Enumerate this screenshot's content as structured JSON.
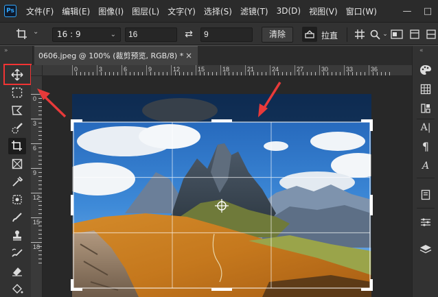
{
  "app": {
    "logo": "Ps"
  },
  "menu": [
    "文件(F)",
    "编辑(E)",
    "图像(I)",
    "图层(L)",
    "文字(Y)",
    "选择(S)",
    "滤镜(T)",
    "3D(D)",
    "视图(V)",
    "窗口(W)"
  ],
  "window_controls": {
    "minimize": "—",
    "maximize": "□"
  },
  "options_bar": {
    "tool_icon": "crop-icon",
    "ratio": "16 : 9",
    "width_value": "16",
    "height_value": "9",
    "swap_icon": "swap-icon",
    "clear_label": "清除",
    "straighten_label": "拉直",
    "icons": [
      "grid-overlay-icon",
      "settings-gear-icon",
      "content-aware-icon"
    ]
  },
  "document": {
    "tab_title": "0606.jpeg @ 100% (裁剪预览, RGB/8) *",
    "close_label": "×"
  },
  "ruler": {
    "h_labels": [
      "0",
      "3",
      "6",
      "9",
      "12",
      "15",
      "18",
      "21",
      "24",
      "27",
      "30",
      "33",
      "36"
    ],
    "v_labels": [
      "0",
      "3",
      "6",
      "9",
      "12",
      "15",
      "18"
    ]
  },
  "toolbar": {
    "tools": [
      "move-tool-icon",
      "marquee-tool-icon",
      "lasso-tool-icon",
      "quick-select-tool-icon",
      "crop-tool-icon",
      "frame-tool-icon",
      "eyedropper-tool-icon",
      "healing-brush-tool-icon",
      "brush-tool-icon",
      "clone-stamp-tool-icon",
      "history-brush-tool-icon",
      "eraser-tool-icon",
      "fill-tool-icon"
    ],
    "active_tool": "crop-tool-icon",
    "highlighted_tool": "move-tool-icon"
  },
  "right_panel": {
    "icons": [
      "color-palette-icon",
      "swatches-grid-icon",
      "libraries-icon",
      "character-icon",
      "paragraph-icon",
      "glyphs-icon",
      "notes-icon",
      "adjustments-icon",
      "layers-icon"
    ]
  },
  "annotations": {
    "arrow_color": "#e83a3a",
    "highlight_color": "#f23434"
  }
}
